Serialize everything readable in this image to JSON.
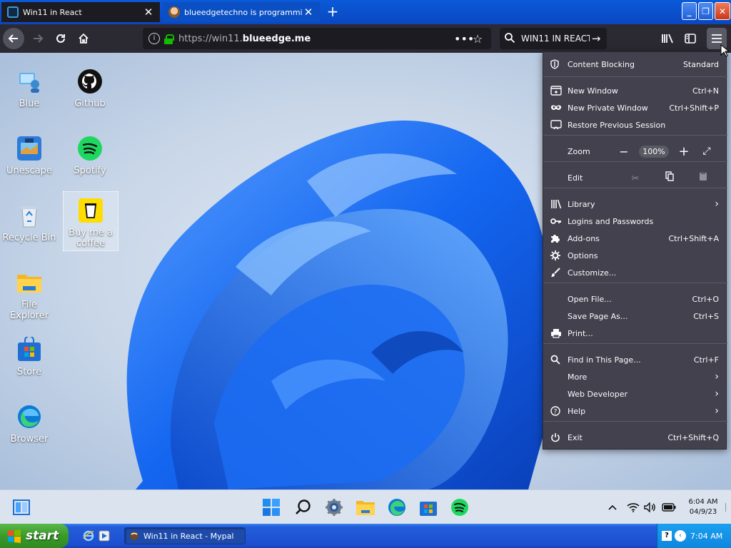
{
  "browser": {
    "tabs": [
      {
        "label": "Win11 in React",
        "active": true
      },
      {
        "label": "blueedgetechno is programming a",
        "active": false
      }
    ],
    "url": {
      "scheme": "https://win11.",
      "domain": "blueedge.me"
    },
    "search": {
      "value": "WIN11 IN REACT"
    }
  },
  "desktop_icons": [
    {
      "label": "Blue"
    },
    {
      "label": "Github"
    },
    {
      "label": "Unescape"
    },
    {
      "label": "Spotify"
    },
    {
      "label": "Recycle Bin"
    },
    {
      "label": "Buy me a coffee"
    },
    {
      "label": "File Explorer"
    },
    {
      "label": "Store"
    },
    {
      "label": "Browser"
    }
  ],
  "menu": {
    "content_blocking": {
      "label": "Content Blocking",
      "value": "Standard"
    },
    "new_window": {
      "label": "New Window",
      "shortcut": "Ctrl+N"
    },
    "new_private_window": {
      "label": "New Private Window",
      "shortcut": "Ctrl+Shift+P"
    },
    "restore_session": {
      "label": "Restore Previous Session"
    },
    "zoom": {
      "label": "Zoom",
      "level": "100%"
    },
    "edit": {
      "label": "Edit"
    },
    "library": {
      "label": "Library"
    },
    "logins": {
      "label": "Logins and Passwords"
    },
    "addons": {
      "label": "Add-ons",
      "shortcut": "Ctrl+Shift+A"
    },
    "options": {
      "label": "Options"
    },
    "customize": {
      "label": "Customize..."
    },
    "open_file": {
      "label": "Open File...",
      "shortcut": "Ctrl+O"
    },
    "save_page": {
      "label": "Save Page As...",
      "shortcut": "Ctrl+S"
    },
    "print": {
      "label": "Print..."
    },
    "find": {
      "label": "Find in This Page...",
      "shortcut": "Ctrl+F"
    },
    "more": {
      "label": "More"
    },
    "web_developer": {
      "label": "Web Developer"
    },
    "help": {
      "label": "Help"
    },
    "exit": {
      "label": "Exit",
      "shortcut": "Ctrl+Shift+Q"
    }
  },
  "win11_taskbar": {
    "time": "6:04 AM",
    "date": "04/9/23"
  },
  "xp_taskbar": {
    "start_label": "start",
    "task_label": "Win11 in React - Mypal",
    "clock": "7:04 AM"
  },
  "colors": {
    "browser_chrome": "#2b2a33",
    "menu_bg": "#42414d",
    "xp_blue": "#245edb",
    "xp_start_green": "#3a9a2a",
    "win11_taskbar": "#dbe4ee"
  }
}
